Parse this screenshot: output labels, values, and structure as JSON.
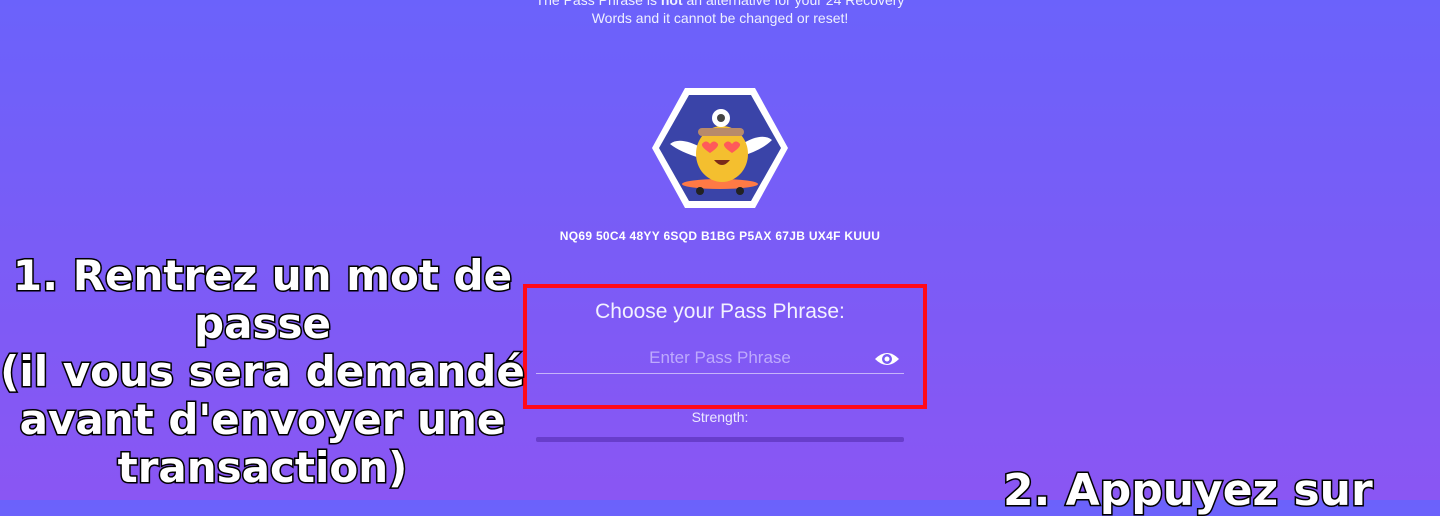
{
  "notice": {
    "line1_pre": "The Pass Phrase is ",
    "line1_bold": "not",
    "line1_post": " an alternative for your 24 Recovery",
    "line2": "Words and it cannot be changed or reset!"
  },
  "account": {
    "address": "NQ69 50C4 48YY 6SQD B1BG P5AX 67JB UX4F KUUU",
    "avatar_icon": "skateboarding-chick-avatar-icon"
  },
  "passphrase": {
    "label": "Choose your Pass Phrase:",
    "placeholder": "Enter Pass Phrase",
    "value": "",
    "visibility_icon": "eye-icon",
    "strength_label": "Strength:"
  },
  "annotations": {
    "step1_lines": [
      "1. Rentrez un mot de",
      "passe",
      "(il vous sera demandé",
      "avant d'envoyer une",
      "transaction)"
    ],
    "step2": "2. Appuyez sur"
  },
  "colors": {
    "background_top": "#6b62fb",
    "background_bottom": "#8a56f3",
    "highlight_border": "#ff0a1a",
    "avatar_hex": "#3a44a8"
  }
}
